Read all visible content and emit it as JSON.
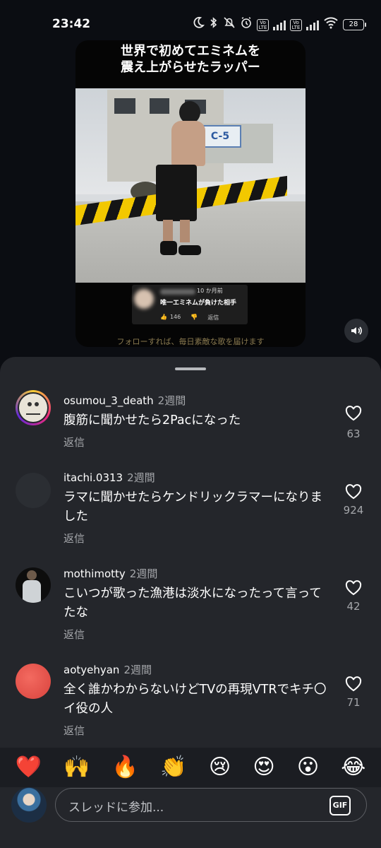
{
  "status_bar": {
    "time": "23:42",
    "volte_label": "Vo LTE",
    "battery": "28",
    "icons": [
      "moon-icon",
      "bluetooth-icon",
      "bell-off-icon",
      "alarm-icon",
      "volte-icon",
      "signal-icon",
      "volte-icon",
      "signal-icon",
      "wifi-icon",
      "battery-icon"
    ]
  },
  "video": {
    "title_line1": "世界で初めてエミネムを",
    "title_line2": "震え上がらせたラッパー",
    "ship_sign": "C-5",
    "sticker": {
      "time": "10 か月前",
      "text": "唯一エミネムが負けた相手",
      "likes": "146",
      "reply": "返信"
    },
    "caption": "フォローすれば、毎日素敵な歌を届けます"
  },
  "comments": [
    {
      "user": "osumou_3_death",
      "time": "2週間",
      "text": "腹筋に聞かせたら2Pacになった",
      "reply": "返信",
      "likes": "63"
    },
    {
      "user": "itachi.0313",
      "time": "2週間",
      "text": "ラマに聞かせたらケンドリックラマーになりました",
      "reply": "返信",
      "likes": "924"
    },
    {
      "user": "mothimotty",
      "time": "2週間",
      "text": "こいつが歌った漁港は淡水になったって言ってたな",
      "reply": "返信",
      "likes": "42"
    },
    {
      "user": "aotyehyan",
      "time": "2週間",
      "text": "全く誰かわからないけどTVの再現VTRでキチ〇イ役の人",
      "reply": "返信",
      "likes": "71"
    }
  ],
  "emoji_bar": [
    "❤️",
    "🙌",
    "🔥",
    "👏",
    "😢",
    "😍",
    "😮",
    "😂"
  ],
  "input": {
    "placeholder": "スレッドに参加...",
    "gif_label": "GIF"
  },
  "colors": {
    "background": "#0b0d12",
    "sheet": "#24262b",
    "secondary_text": "#a5a7ab",
    "story_ring": "#e1306c"
  }
}
